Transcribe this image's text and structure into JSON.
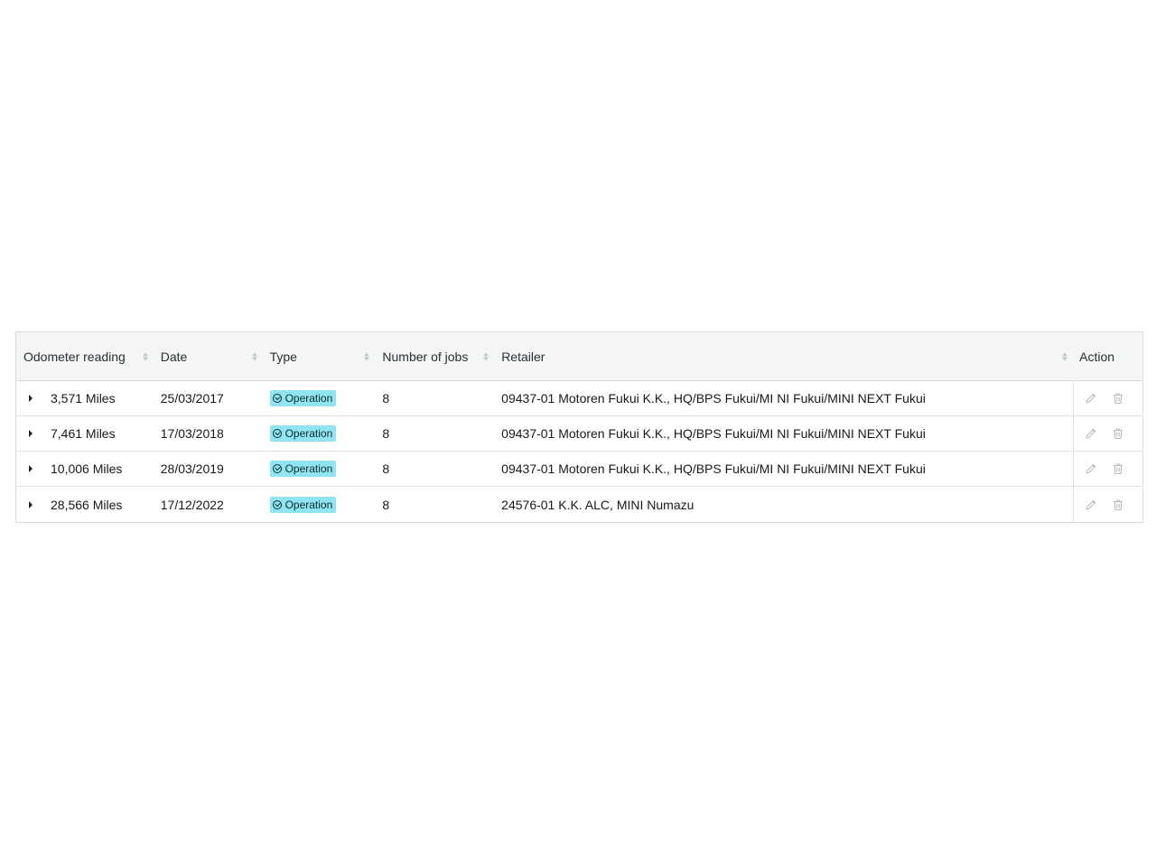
{
  "table": {
    "columns": [
      {
        "key": "odometer",
        "label": "Odometer reading",
        "sortable": true
      },
      {
        "key": "date",
        "label": "Date",
        "sortable": true
      },
      {
        "key": "type",
        "label": "Type",
        "sortable": true
      },
      {
        "key": "jobs",
        "label": "Number of jobs",
        "sortable": true
      },
      {
        "key": "retailer",
        "label": "Retailer",
        "sortable": true
      },
      {
        "key": "action",
        "label": "Action",
        "sortable": false
      }
    ],
    "rows": [
      {
        "odometer": "3,571 Miles",
        "date": "25/03/2017",
        "type": "Operation",
        "jobs": "8",
        "retailer": "09437-01 Motoren Fukui K.K., HQ/BPS Fukui/MI NI Fukui/MINI NEXT Fukui"
      },
      {
        "odometer": "7,461 Miles",
        "date": "17/03/2018",
        "type": "Operation",
        "jobs": "8",
        "retailer": "09437-01 Motoren Fukui K.K., HQ/BPS Fukui/MI NI Fukui/MINI NEXT Fukui"
      },
      {
        "odometer": "10,006 Miles",
        "date": "28/03/2019",
        "type": "Operation",
        "jobs": "8",
        "retailer": "09437-01 Motoren Fukui K.K., HQ/BPS Fukui/MI NI Fukui/MINI NEXT Fukui"
      },
      {
        "odometer": "28,566 Miles",
        "date": "17/12/2022",
        "type": "Operation",
        "jobs": "8",
        "retailer": "24576-01 K.K. ALC, MINI Numazu"
      }
    ]
  },
  "icons": {
    "expand": "caret-right-icon",
    "type_tag": "check-circle-icon",
    "edit": "pencil-icon",
    "delete": "trash-icon",
    "sort": "sort-icon"
  },
  "colors": {
    "tag_bg": "#8fe6f2",
    "header_bg": "#f4f5f5",
    "border": "#d9dbdb",
    "action_icon": "#b9bdc0"
  }
}
